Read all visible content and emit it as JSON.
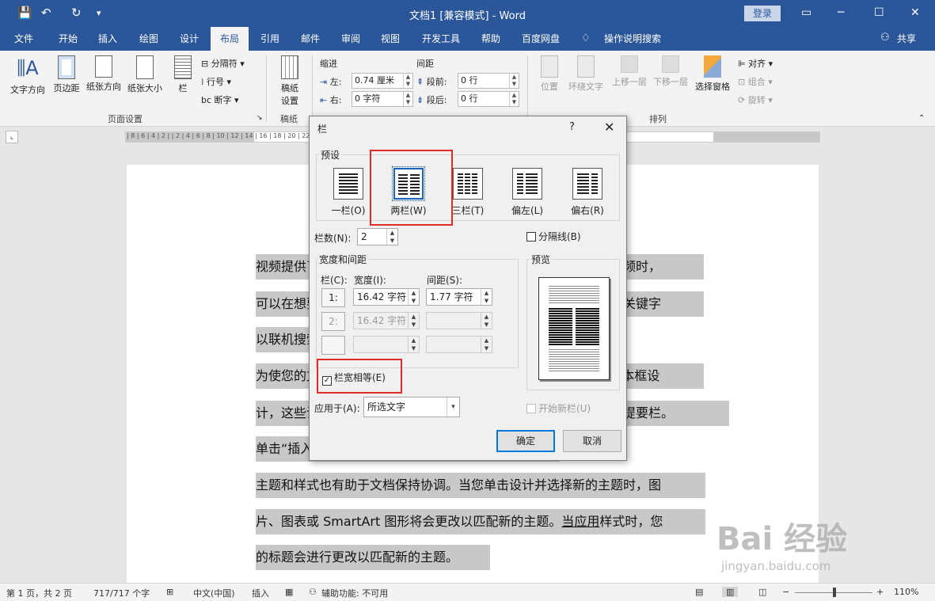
{
  "titlebar": {
    "title": "文档1 [兼容模式]  -  Word",
    "login": "登录",
    "qa_save": "💾",
    "qa_undo": "↶",
    "qa_redo": "↻",
    "qa_more": "▾"
  },
  "tabs": [
    "文件",
    "开始",
    "插入",
    "绘图",
    "设计",
    "布局",
    "引用",
    "邮件",
    "审阅",
    "视图",
    "开发工具",
    "帮助",
    "百度网盘",
    "操作说明搜索"
  ],
  "active_tab": "布局",
  "share": "共享",
  "ribbon": {
    "page_setup": {
      "text_direction": "文字方向",
      "margins": "页边距",
      "orientation": "纸张方向",
      "size": "纸张大小",
      "columns": "栏",
      "breaks": "分隔符",
      "line_numbers": "行号",
      "hyphenation": "断字",
      "group_label": "页面设置"
    },
    "manuscript": {
      "label": "稿纸\n设置",
      "group_label": "稿纸"
    },
    "paragraph": {
      "indent_label": "缩进",
      "spacing_label": "间距",
      "left_label": "左:",
      "left_value": "0.74 厘米",
      "right_label": "右:",
      "right_value": "0 字符",
      "before_label": "段前:",
      "before_value": "0 行",
      "after_label": "段后:",
      "after_value": "0 行",
      "group_label": "段落"
    },
    "arrange": {
      "position": "位置",
      "wrap_text": "环绕文字",
      "bring_forward": "上移一层",
      "send_backward": "下移一层",
      "selection_pane": "选择窗格",
      "align": "对齐",
      "group": "组合",
      "rotate": "旋转",
      "group_label": "排列"
    }
  },
  "ruler_ticks": "| 8 | 6 | 4 | 2 |   | 2 | 4 | 6 | 8 | 10 | 12 | 14 | 16 | 18 | 20 | 22 | 24 | 26 | 28 | 30 | 32 | 34 | 36 | 38 | 40 | 42",
  "document": {
    "lines": [
      "视频提供了功能强大的方法帮助您证明您的观点。当您单击联机视频时，",
      "可以在想要添加的视频的嵌入代码中进行粘贴。您也可以键入一个关键字",
      "以联机搜索最适合您的文档的视频。",
      "为使您的文档具有专业外观，Word 提供了页眉、页脚、封面和文本框设",
      "计，这些设计可互为补充。例如，您可以添加匹配的封面、页眉和提要栏。",
      "单击“插入”，然后从不同库中选择所需元素。",
      "主题和样式也有助于文档保持协调。当您单击设计并选择新的主题时，图",
      "片、图表或 SmartArt 图形将会更改以匹配新的主题。",
      "的标题会进行更改以匹配新的主题。"
    ],
    "line8_link": "当应用",
    "line8_rest": "样式时，您"
  },
  "dialog": {
    "title": "栏",
    "help": "?",
    "close": "✕",
    "presets_label": "预设",
    "presets": [
      "一栏(O)",
      "两栏(W)",
      "三栏(T)",
      "偏左(L)",
      "偏右(R)"
    ],
    "num_columns_label": "栏数(N):",
    "num_columns_value": "2",
    "line_between": "分隔线(B)",
    "width_spacing_label": "宽度和间距",
    "col_label": "栏(C):",
    "width_label": "宽度(I):",
    "spacing_label": "间距(S):",
    "rows": [
      {
        "num": "1:",
        "width": "16.42 字符",
        "spacing": "1.77 字符"
      },
      {
        "num": "2:",
        "width": "16.42 字符",
        "spacing": ""
      },
      {
        "num": "",
        "width": "",
        "spacing": ""
      }
    ],
    "equal_width": "栏宽相等(E)",
    "equal_width_check": "✓",
    "preview_label": "预览",
    "apply_to_label": "应用于(A):",
    "apply_to_value": "所选文字",
    "start_new_column": "开始新栏(U)",
    "ok": "确定",
    "cancel": "取消"
  },
  "statusbar": {
    "page": "第 1 页，共 2 页",
    "words": "717/717 个字",
    "language": "中文(中国)",
    "insert": "插入",
    "accessibility": "辅助功能: 不可用",
    "zoom": "110%"
  },
  "watermark": {
    "big": "Bai 经验",
    "small": "jingyan.baidu.com"
  }
}
